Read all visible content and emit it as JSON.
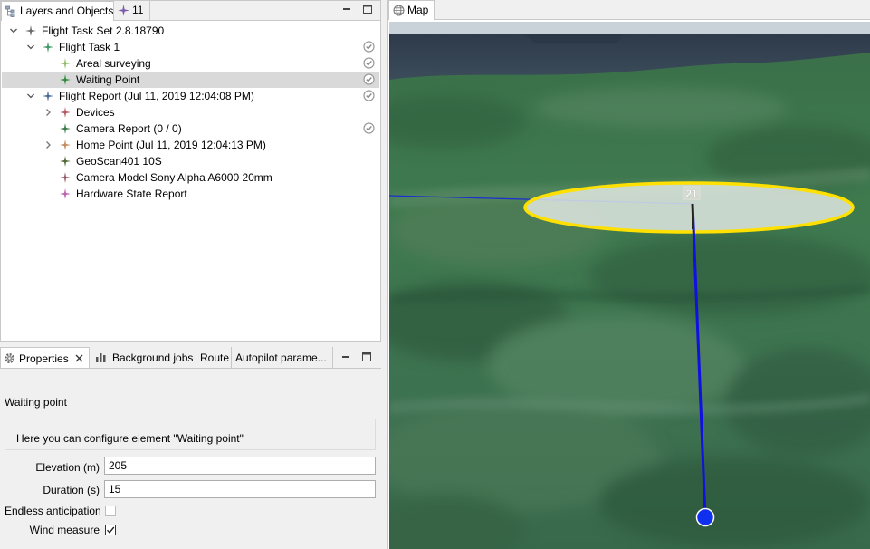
{
  "layers_panel": {
    "tabs": [
      {
        "label": "Layers and Objects",
        "icon": "layers-icon"
      },
      {
        "label": "11",
        "icon": "waypoint-icon"
      }
    ],
    "tree": [
      {
        "label": "Flight Task Set 2.8.18790",
        "level": 0,
        "expanded": true,
        "icon": "waypoint-icon",
        "icon_color": "#6b6b6b",
        "checked": false,
        "selected": false
      },
      {
        "label": "Flight Task 1",
        "level": 1,
        "expanded": true,
        "icon": "waypoint-icon",
        "icon_color": "#3e9a64",
        "checked": true,
        "selected": false
      },
      {
        "label": "Areal surveying",
        "level": 2,
        "expanded": null,
        "icon": "waypoint-icon",
        "icon_color": "#8fbf6a",
        "checked": true,
        "selected": false
      },
      {
        "label": "Waiting Point",
        "level": 2,
        "expanded": null,
        "icon": "waypoint-icon",
        "icon_color": "#2e8b3e",
        "checked": true,
        "selected": true
      },
      {
        "label": "Flight Report (Jul 11, 2019 12:04:08 PM)",
        "level": 1,
        "expanded": true,
        "icon": "waypoint-icon",
        "icon_color": "#4a6b9a",
        "checked": true,
        "selected": false
      },
      {
        "label": "Devices",
        "level": 2,
        "expanded": false,
        "icon": "waypoint-icon",
        "icon_color": "#b5555f",
        "checked": false,
        "selected": false
      },
      {
        "label": "Camera Report (0 / 0)",
        "level": 2,
        "expanded": null,
        "icon": "waypoint-icon",
        "icon_color": "#3a7a4a",
        "checked": true,
        "selected": false
      },
      {
        "label": "Home Point  (Jul 11, 2019 12:04:13 PM)",
        "level": 2,
        "expanded": false,
        "icon": "waypoint-icon",
        "icon_color": "#c48a5a",
        "checked": false,
        "selected": false
      },
      {
        "label": "GeoScan401 10S",
        "level": 2,
        "expanded": null,
        "icon": "waypoint-icon",
        "icon_color": "#4f6a3a",
        "checked": false,
        "selected": false
      },
      {
        "label": "Camera Model Sony Alpha A6000 20mm",
        "level": 2,
        "expanded": null,
        "icon": "waypoint-icon",
        "icon_color": "#9a5a68",
        "checked": false,
        "selected": false
      },
      {
        "label": "Hardware State Report",
        "level": 2,
        "expanded": null,
        "icon": "waypoint-icon",
        "icon_color": "#c060b0",
        "checked": false,
        "selected": false
      }
    ]
  },
  "properties_panel": {
    "tabs": [
      {
        "label": "Properties",
        "icon": "gear-icon",
        "closable": true
      },
      {
        "label": "Background jobs",
        "icon": "bar-chart-icon",
        "closable": false
      },
      {
        "label": "Route",
        "icon": null,
        "closable": false
      },
      {
        "label": "Autopilot parame...",
        "icon": null,
        "closable": false
      }
    ],
    "section_title": "Waiting point",
    "description": "Here you can configure element \"Waiting point\"",
    "fields": {
      "elevation": {
        "label": "Elevation (m)",
        "value": "205"
      },
      "duration": {
        "label": "Duration (s)",
        "value": "15"
      },
      "endless": {
        "label": "Endless anticipation",
        "checked": false
      },
      "wind": {
        "label": "Wind measure",
        "checked": true
      }
    }
  },
  "map_panel": {
    "tab": {
      "label": "Map",
      "icon": "globe-icon"
    },
    "waypoint_number": "21",
    "colors": {
      "ring": "#ffe000",
      "route": "#1010e0",
      "marker": "#1030f0"
    }
  }
}
